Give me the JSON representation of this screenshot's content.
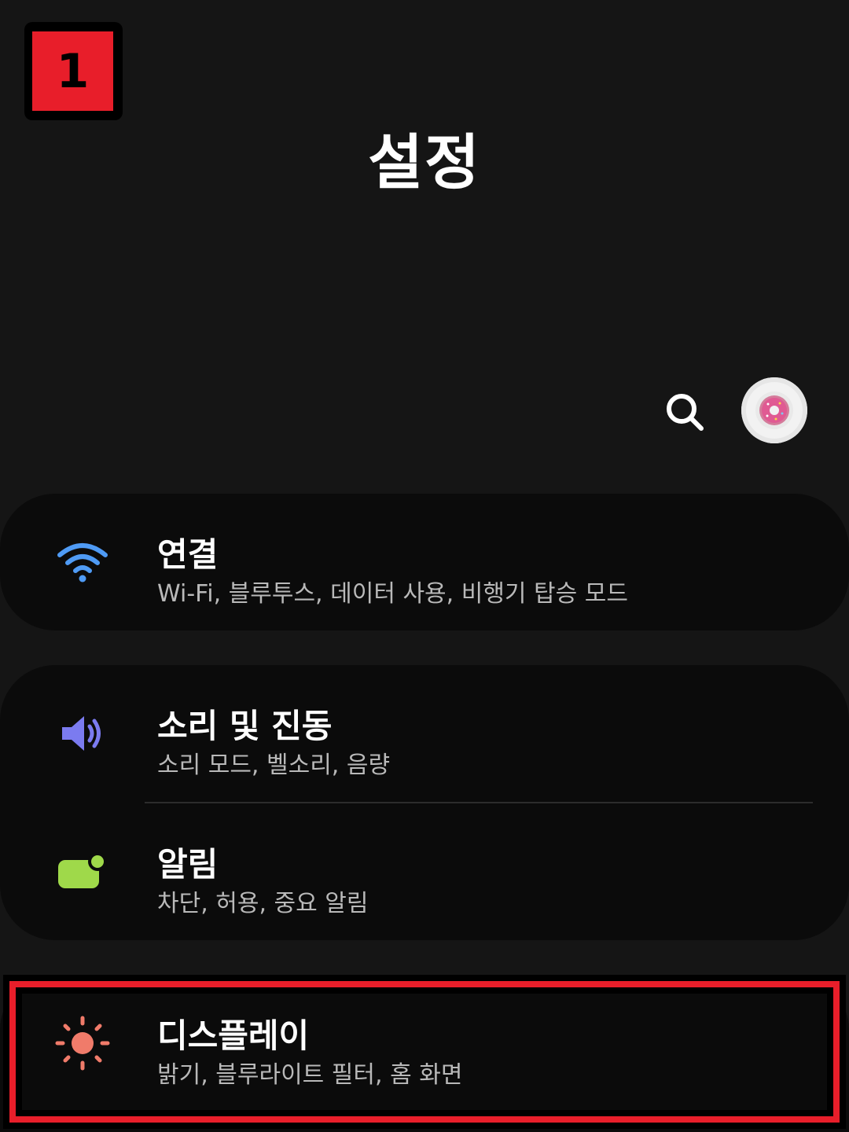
{
  "step_badge": "1",
  "page_title": "설정",
  "header_icons": {
    "search": "search-icon",
    "avatar": "donut-avatar"
  },
  "colors": {
    "wifi": "#4f9bf5",
    "sound": "#7b7bf0",
    "notification": "#9fd94a",
    "display": "#f07b6a",
    "highlight": "#e81e2a"
  },
  "settings": [
    {
      "title": "연결",
      "subtitle": "Wi-Fi, 블루투스, 데이터 사용, 비행기 탑승 모드",
      "icon": "wifi-icon"
    },
    {
      "title": "소리 및 진동",
      "subtitle": "소리 모드, 벨소리, 음량",
      "icon": "speaker-icon"
    },
    {
      "title": "알림",
      "subtitle": "차단, 허용, 중요 알림",
      "icon": "notification-icon"
    },
    {
      "title": "디스플레이",
      "subtitle": "밝기, 블루라이트 필터, 홈 화면",
      "icon": "sun-icon"
    }
  ]
}
